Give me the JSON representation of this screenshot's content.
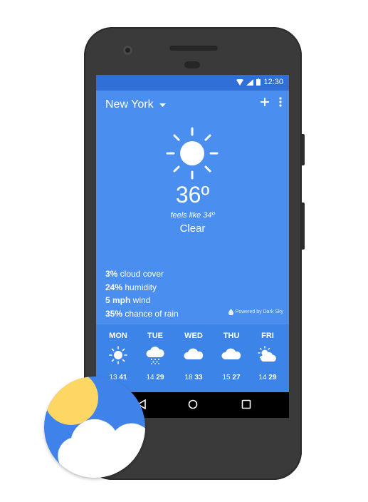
{
  "status": {
    "time": "12:30",
    "icons": [
      "wifi-icon",
      "signal-icon",
      "battery-icon"
    ]
  },
  "toolbar": {
    "city": "New York",
    "dropdown_icon": "caret-down-icon",
    "add_icon": "plus-icon",
    "menu_icon": "more-vert-icon"
  },
  "current": {
    "icon": "sun-icon",
    "temperature": "36º",
    "feels_like": "feels like 34º",
    "summary": "Clear"
  },
  "details": [
    {
      "value": "3%",
      "label": " cloud cover"
    },
    {
      "value": "24%",
      "label": " humidity"
    },
    {
      "value": "5 mph",
      "label": " wind"
    },
    {
      "value": "35%",
      "label": " chance of rain"
    }
  ],
  "attribution": "Powered by Dark Sky",
  "forecast": [
    {
      "day": "MON",
      "icon": "sun-icon",
      "low": "13",
      "high": "41"
    },
    {
      "day": "TUE",
      "icon": "snow-cloud-icon",
      "low": "14",
      "high": "29"
    },
    {
      "day": "WED",
      "icon": "cloud-icon",
      "low": "18",
      "high": "33"
    },
    {
      "day": "THU",
      "icon": "cloud-icon",
      "low": "15",
      "high": "27"
    },
    {
      "day": "FRI",
      "icon": "partly-cloudy-icon",
      "low": "14",
      "high": "29"
    }
  ],
  "nav": [
    "back-icon",
    "home-icon",
    "recents-icon"
  ],
  "colors": {
    "screen_bg": "#4a8ff0",
    "status_bg": "#2f6fd6",
    "forecast_bg": "#3d84e8",
    "badge_sun": "#fdd663"
  }
}
